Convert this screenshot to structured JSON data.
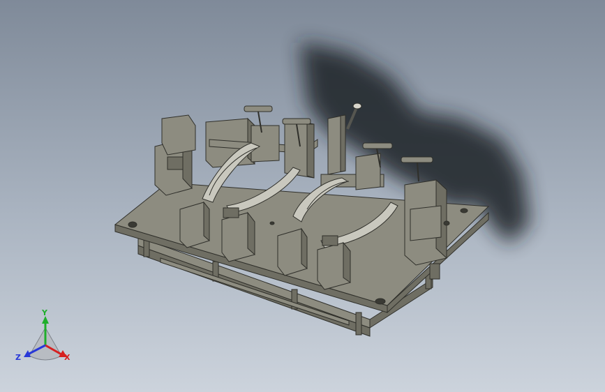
{
  "viewport": {
    "background_top": "#7f8a99",
    "background_bottom": "#ccd3dc",
    "model_color": "#8d8c80",
    "model_shade": "#6f6e63",
    "model_edge": "#2f2f2a",
    "shadow_color": "#1f2328"
  },
  "triad": {
    "x_label": "X",
    "y_label": "Y",
    "z_label": "Z",
    "x_color": "#d62020",
    "y_color": "#1fae2b",
    "z_color": "#2838d8"
  }
}
